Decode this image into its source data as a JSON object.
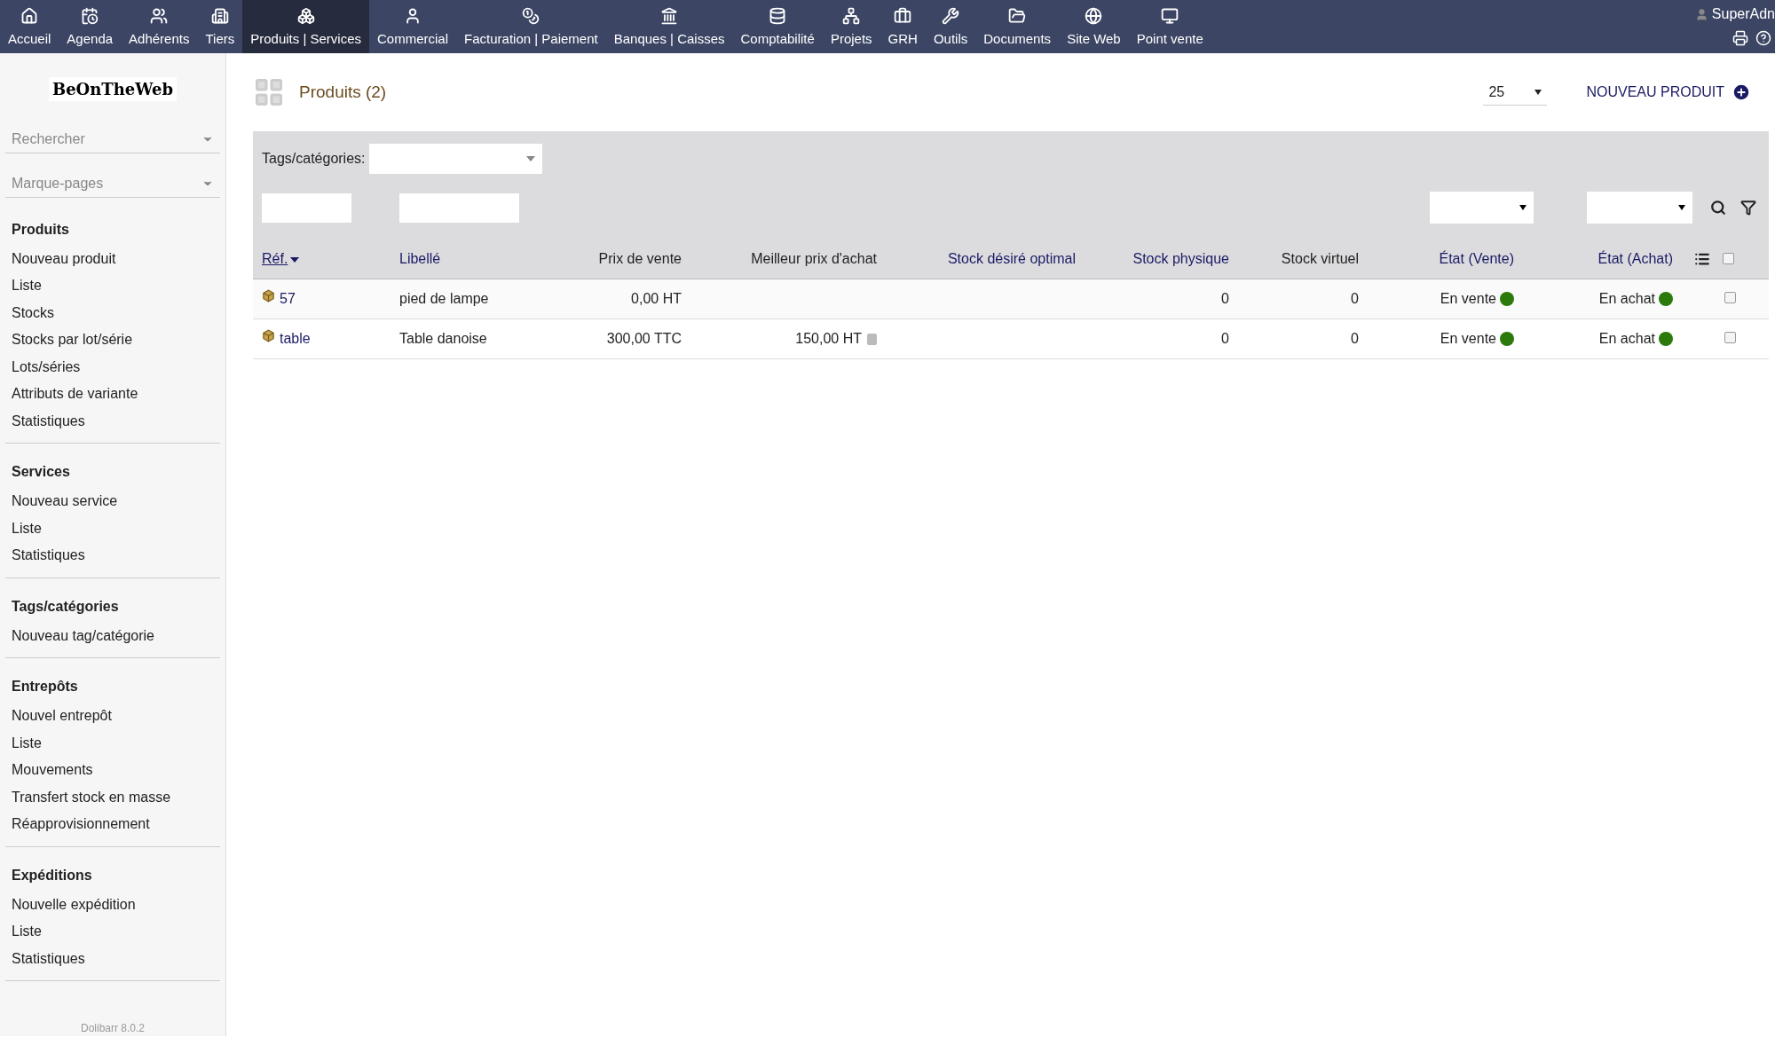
{
  "topbar": {
    "items": [
      {
        "label": "Accueil",
        "selected": false
      },
      {
        "label": "Agenda",
        "selected": false
      },
      {
        "label": "Adhérents",
        "selected": false
      },
      {
        "label": "Tiers",
        "selected": false
      },
      {
        "label": "Produits | Services",
        "selected": true
      },
      {
        "label": "Commercial",
        "selected": false
      },
      {
        "label": "Facturation | Paiement",
        "selected": false
      },
      {
        "label": "Banques | Caisses",
        "selected": false
      },
      {
        "label": "Comptabilité",
        "selected": false
      },
      {
        "label": "Projets",
        "selected": false
      },
      {
        "label": "GRH",
        "selected": false
      },
      {
        "label": "Outils",
        "selected": false
      },
      {
        "label": "Documents",
        "selected": false
      },
      {
        "label": "Site Web",
        "selected": false
      },
      {
        "label": "Point vente",
        "selected": false
      }
    ],
    "user": "SuperAdn"
  },
  "sidebar": {
    "logo": "BeOnTheWeb",
    "search_placeholder": "Rechercher",
    "bookmarks_placeholder": "Marque-pages",
    "sections": [
      {
        "title": "Produits",
        "items": [
          "Nouveau produit",
          "Liste",
          "Stocks",
          "Stocks par lot/série",
          "Lots/séries",
          "Attributs de variante",
          "Statistiques"
        ]
      },
      {
        "title": "Services",
        "items": [
          "Nouveau service",
          "Liste",
          "Statistiques"
        ]
      },
      {
        "title": "Tags/catégories",
        "items": [
          "Nouveau tag/catégorie"
        ]
      },
      {
        "title": "Entrepôts",
        "items": [
          "Nouvel entrepôt",
          "Liste",
          "Mouvements",
          "Transfert stock en masse",
          "Réapprovisionnement"
        ]
      },
      {
        "title": "Expéditions",
        "items": [
          "Nouvelle expédition",
          "Liste",
          "Statistiques"
        ]
      }
    ],
    "version": "Dolibarr 8.0.2"
  },
  "page": {
    "title": "Produits (2)",
    "per_page": "25",
    "new_button": "NOUVEAU PRODUIT",
    "tags_label": "Tags/catégories:"
  },
  "table": {
    "select_all_checked": false,
    "columns": [
      {
        "label": "Réf.",
        "sortable": true,
        "sorted": true
      },
      {
        "label": "Libellé",
        "sortable": true,
        "sorted": false
      },
      {
        "label": "Prix de vente",
        "sortable": false,
        "sorted": false
      },
      {
        "label": "Meilleur prix d'achat",
        "sortable": false,
        "sorted": false
      },
      {
        "label": "Stock désiré optimal",
        "sortable": true,
        "sorted": false
      },
      {
        "label": "Stock physique",
        "sortable": true,
        "sorted": false
      },
      {
        "label": "Stock virtuel",
        "sortable": false,
        "sorted": false
      },
      {
        "label": "État (Vente)",
        "sortable": true,
        "sorted": false
      },
      {
        "label": "État (Achat)",
        "sortable": true,
        "sorted": false
      }
    ],
    "rows": [
      {
        "ref": "57",
        "label": "pied de lampe",
        "sell_price": "0,00 HT",
        "buy_price": "",
        "buy_price_help": false,
        "stock_optimal": "",
        "stock_physical": "0",
        "stock_virtual": "0",
        "sale_status": "En vente",
        "on_sale": true,
        "buy_status": "En achat",
        "on_buy": true,
        "checked": false
      },
      {
        "ref": "table",
        "label": "Table danoise",
        "sell_price": "300,00 TTC",
        "buy_price": "150,00 HT",
        "buy_price_help": true,
        "stock_optimal": "",
        "stock_physical": "0",
        "stock_virtual": "0",
        "sale_status": "En vente",
        "on_sale": true,
        "buy_status": "En achat",
        "on_buy": true,
        "checked": false
      }
    ]
  }
}
